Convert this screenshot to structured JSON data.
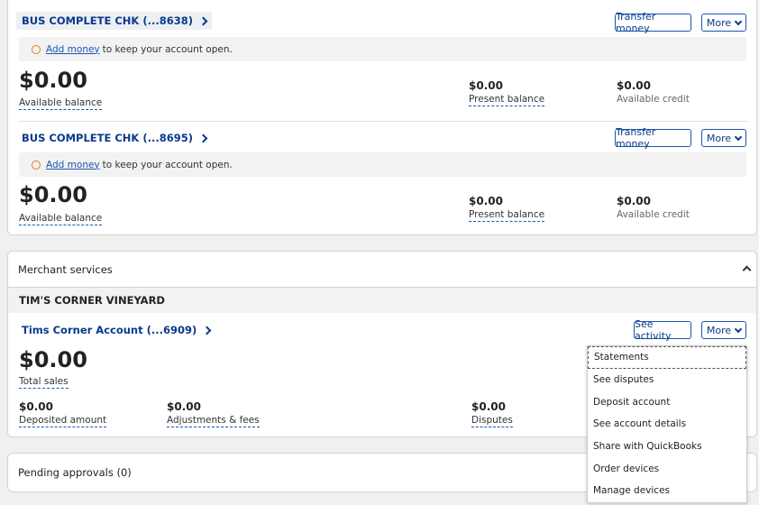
{
  "accounts": [
    {
      "name": "BUS COMPLETE CHK (...8638)",
      "transfer": "Transfer money",
      "more": "More",
      "notice_link": "Add money",
      "notice_text": "to keep your account open.",
      "available": "$0.00",
      "available_label": "Available balance",
      "present": "$0.00",
      "present_label": "Present balance",
      "credit": "$0.00",
      "credit_label": "Available credit"
    },
    {
      "name": "BUS COMPLETE CHK (...8695)",
      "transfer": "Transfer money",
      "more": "More",
      "notice_link": "Add money",
      "notice_text": "to keep your account open.",
      "available": "$0.00",
      "available_label": "Available balance",
      "present": "$0.00",
      "present_label": "Present balance",
      "credit": "$0.00",
      "credit_label": "Available credit"
    }
  ],
  "merchant": {
    "title": "Merchant services",
    "business": "TIM'S CORNER VINEYARD",
    "account": "Tims Corner Account (...6909)",
    "see_activity": "See activity",
    "more": "More",
    "total": "$0.00",
    "total_label": "Total sales",
    "deposited": "$0.00",
    "deposited_label": "Deposited amount",
    "adjustments": "$0.00",
    "adjustments_label": "Adjustments & fees",
    "disputes": "$0.00",
    "disputes_label": "Disputes"
  },
  "menu": {
    "items": [
      "Statements",
      "See disputes",
      "Deposit account",
      "See account details",
      "Share with QuickBooks",
      "Order devices",
      "Manage devices"
    ]
  },
  "pending": {
    "title": "Pending approvals (0)"
  }
}
